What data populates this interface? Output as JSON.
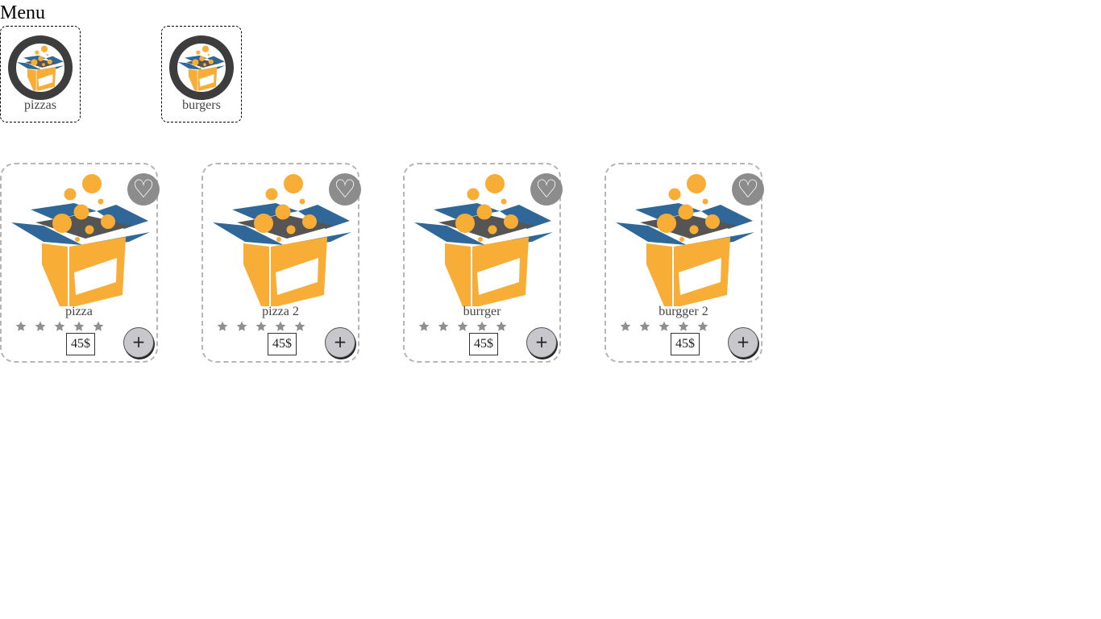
{
  "header": {
    "title": "Menu"
  },
  "categories": [
    {
      "label": "pizzas",
      "icon": "open-box-icon"
    },
    {
      "label": "burgers",
      "icon": "open-box-icon"
    }
  ],
  "products": [
    {
      "name": "pizza",
      "price": "45$",
      "rating": 0,
      "max_rating": 5,
      "favorite_icon": "♡",
      "add_icon": "+"
    },
    {
      "name": "pizza 2",
      "price": "45$",
      "rating": 0,
      "max_rating": 5,
      "favorite_icon": "♡",
      "add_icon": "+"
    },
    {
      "name": "burrger",
      "price": "45$",
      "rating": 0,
      "max_rating": 5,
      "favorite_icon": "♡",
      "add_icon": "+"
    },
    {
      "name": "burgger 2",
      "price": "45$",
      "rating": 0,
      "max_rating": 5,
      "favorite_icon": "♡",
      "add_icon": "+"
    }
  ],
  "colors": {
    "box_orange": "#f8ad36",
    "box_blue": "#2f6898",
    "box_inside": "#555555",
    "ring": "#3d3d3d",
    "fav_bg": "#8c8c8c",
    "add_bg": "#c8c8cc",
    "star": "#8f8f8f"
  }
}
